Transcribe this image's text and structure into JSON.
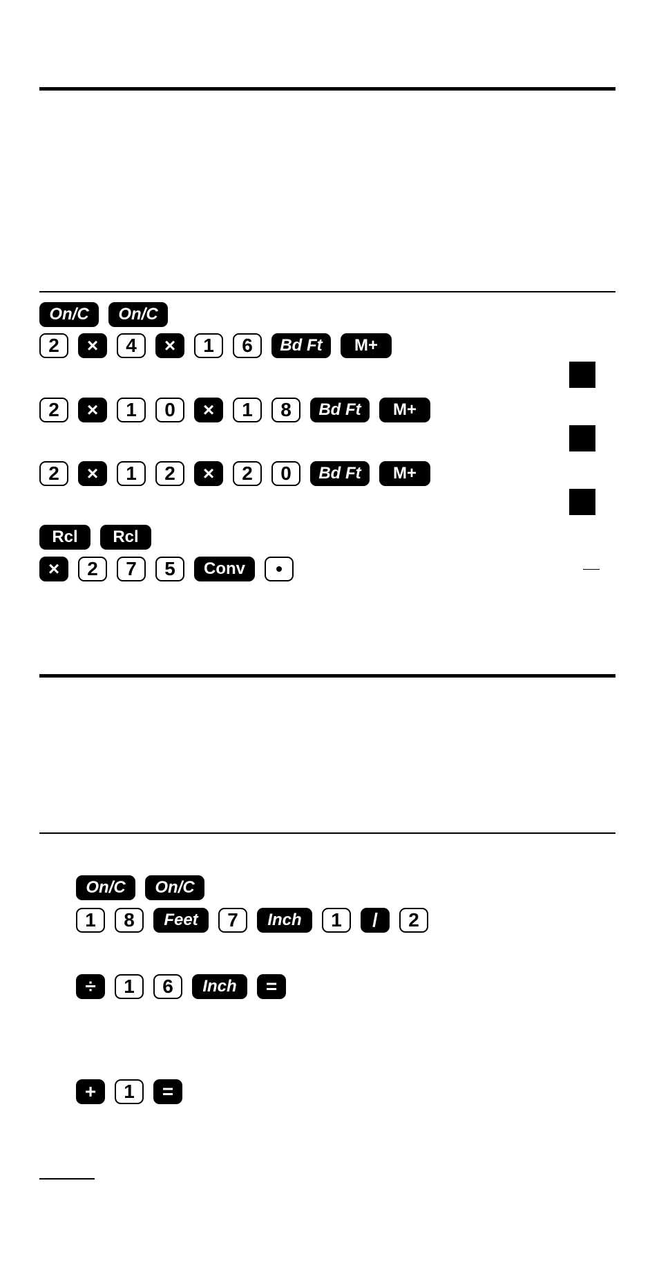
{
  "section1": {
    "rows": [
      [
        "On/C",
        "On/C"
      ],
      [
        "2",
        "×",
        "4",
        "×",
        "1",
        "6",
        "Bd Ft",
        "M+"
      ],
      [
        "2",
        "×",
        "1",
        "0",
        "×",
        "1",
        "8",
        "Bd Ft",
        "M+"
      ],
      [
        "2",
        "×",
        "1",
        "2",
        "×",
        "2",
        "0",
        "Bd Ft",
        "M+"
      ],
      [
        "Rcl",
        "Rcl"
      ],
      [
        "×",
        "2",
        "7",
        "5",
        "Conv",
        "•"
      ]
    ]
  },
  "section2": {
    "rows": [
      [
        "On/C",
        "On/C"
      ],
      [
        "1",
        "8",
        "Feet",
        "7",
        "Inch",
        "1",
        "/",
        "2"
      ],
      [
        "÷",
        "1",
        "6",
        "Inch",
        "="
      ],
      [
        "+",
        "1",
        "="
      ]
    ]
  }
}
